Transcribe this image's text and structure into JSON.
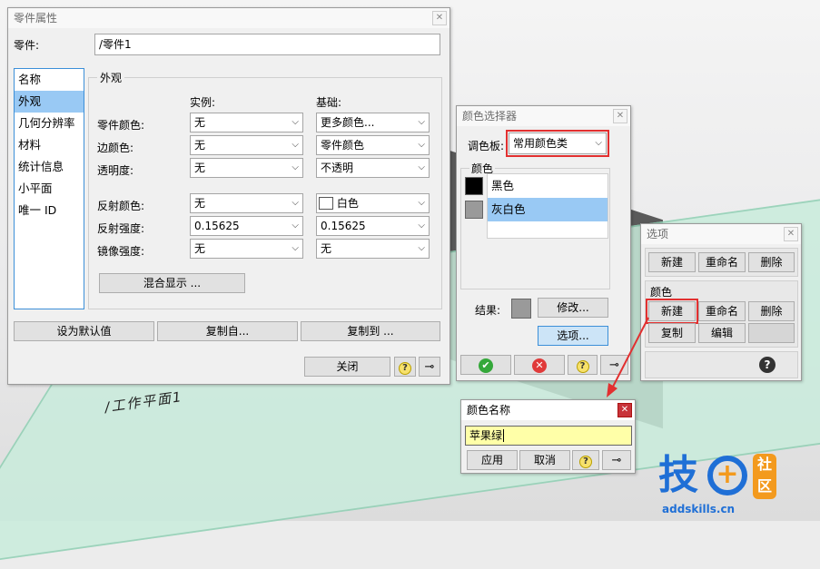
{
  "props_panel": {
    "title": "零件属性",
    "part_label": "零件:",
    "part_value": "/零件1",
    "nav_items": [
      "名称",
      "外观",
      "几何分辨率",
      "材料",
      "统计信息",
      "小平面",
      "唯一 ID"
    ],
    "selected_nav": "外观",
    "group_title": "外观",
    "col_instance": "实例:",
    "col_base": "基础:",
    "rows": [
      {
        "label": "零件颜色:",
        "instance": "无",
        "base": "更多颜色..."
      },
      {
        "label": "边颜色:",
        "instance": "无",
        "base": "零件颜色"
      },
      {
        "label": "透明度:",
        "instance": "无",
        "base": "不透明"
      },
      {
        "label": "反射颜色:",
        "instance": "无",
        "base": "白色"
      },
      {
        "label": "反射强度:",
        "instance": "0.15625",
        "base": "0.15625"
      },
      {
        "label": "镜像强度:",
        "instance": "无",
        "base": "无"
      }
    ],
    "blend_button": "混合显示 ...",
    "set_default": "设为默认值",
    "copy_from": "复制自...",
    "copy_to": "复制到 ...",
    "close": "关闭"
  },
  "picker_panel": {
    "title": "颜色选择器",
    "palette_label": "调色板:",
    "palette_value": "常用颜色类",
    "color_group": "颜色",
    "colors": [
      {
        "name": "黑色",
        "hex": "#000000"
      },
      {
        "name": "灰白色",
        "hex": "#9a9a9a"
      }
    ],
    "selected_color": "灰白色",
    "result_label": "结果:",
    "modify": "修改...",
    "options": "选项..."
  },
  "options_panel": {
    "title": "选项",
    "new": "新建",
    "rename": "重命名",
    "delete": "删除",
    "color_group": "颜色",
    "copy": "复制",
    "edit": "编辑"
  },
  "name_dialog": {
    "title": "颜色名称",
    "input_value": "苹果绿",
    "apply": "应用",
    "cancel": "取消"
  },
  "scene": {
    "plane_label": "/工作平面1"
  },
  "watermark": {
    "brand": "技",
    "badge_top": "社",
    "badge_bottom": "区",
    "url": "addskills.cn"
  },
  "colors": {
    "highlight_red": "#e23030",
    "selection_blue": "#99c9f4",
    "plane_green": "#c9ecdc",
    "input_yellow": "#ffffa8",
    "logo_blue": "#1f6fd6",
    "logo_orange": "#f39a1e"
  }
}
